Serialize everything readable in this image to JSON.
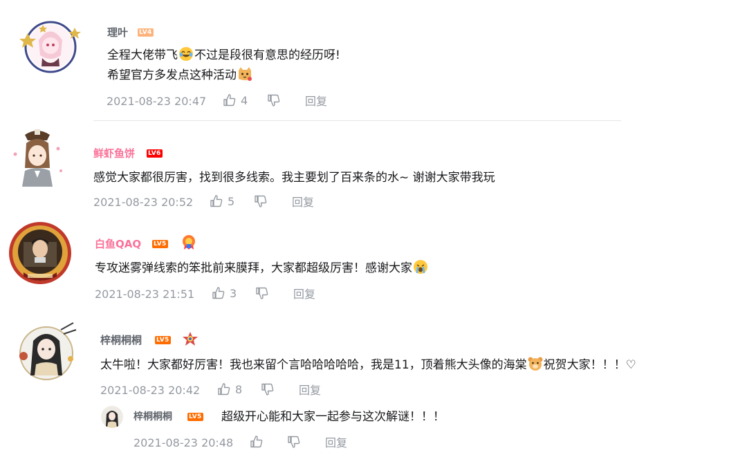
{
  "comments": [
    {
      "username": "理叶",
      "username_color": "#61666d",
      "level": "LV4",
      "level_color": "#ffb37c",
      "text_line1_a": "全程大佬带飞",
      "text_line1_b": "不过是段很有意思的经历呀!",
      "text_line2": "希望官方多发点这种活动",
      "timestamp": "2021-08-23 20:47",
      "likes": "4",
      "reply_label": "回复"
    },
    {
      "username": "鲜虾鱼饼",
      "username_color": "#fb7299",
      "level": "LV6",
      "level_color": "#ff0000",
      "text": "感觉大家都很厉害，找到很多线索。我主要划了百来条的水~ 谢谢大家带我玩",
      "timestamp": "2021-08-23 20:52",
      "likes": "5",
      "reply_label": "回复"
    },
    {
      "username": "白鱼QAQ",
      "username_color": "#fb7299",
      "level": "LV5",
      "level_color": "#ff6c00",
      "text": "专攻迷雾弹线索的笨批前来膜拜，大家都超级厉害！感谢大家",
      "timestamp": "2021-08-23 21:51",
      "likes": "3",
      "reply_label": "回复"
    },
    {
      "username": "梓桐桐桐",
      "username_color": "#61666d",
      "level": "LV5",
      "level_color": "#ff6c00",
      "text_a": "太牛啦！大家都好厉害！我也来留个言哈哈哈哈哈，我是11，顶着熊大头像的海棠",
      "text_b": "祝贺大家！！！♡",
      "timestamp": "2021-08-23 20:42",
      "likes": "8",
      "reply_label": "回复"
    }
  ],
  "reply": {
    "username": "梓桐桐桐",
    "level": "LV5",
    "level_color": "#ff6c00",
    "text": "超级开心能和大家一起参与这次解谜！！！",
    "timestamp": "2021-08-23 20:48",
    "reply_label": "回复"
  },
  "icons": {
    "like": "thumbs-up-icon",
    "dislike": "thumbs-down-icon"
  }
}
